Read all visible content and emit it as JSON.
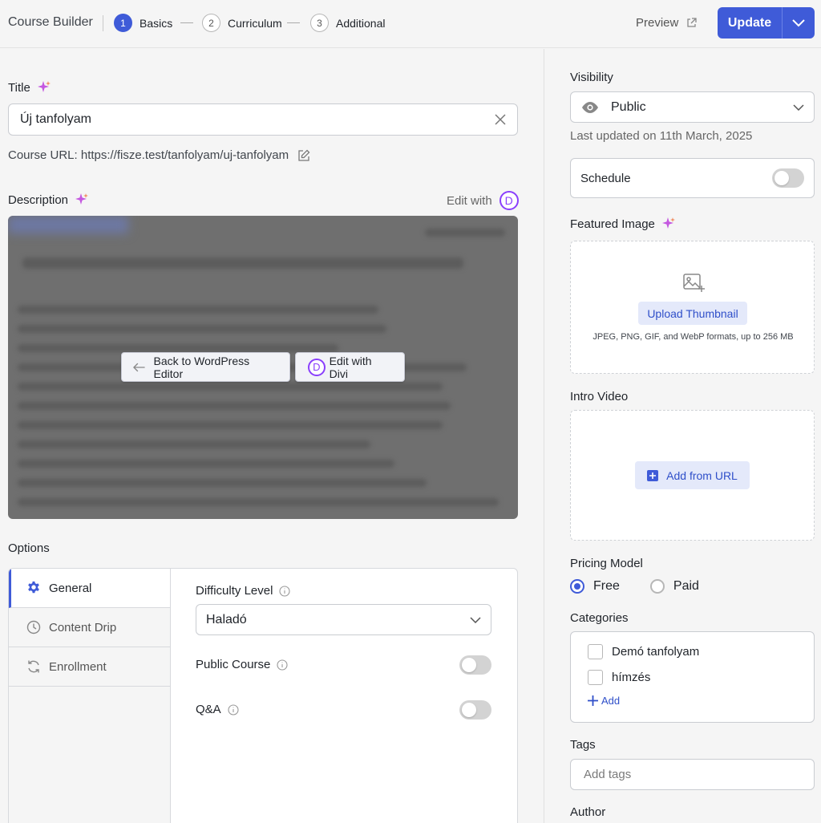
{
  "header": {
    "app_title": "Course Builder",
    "steps": [
      {
        "num": "1",
        "label": "Basics"
      },
      {
        "num": "2",
        "label": "Curriculum"
      },
      {
        "num": "3",
        "label": "Additional"
      }
    ],
    "preview_label": "Preview",
    "update_label": "Update"
  },
  "main": {
    "title_label": "Title",
    "title_value": "Új tanfolyam",
    "course_url": "Course URL: https://fisze.test/tanfolyam/uj-tanfolyam",
    "description_label": "Description",
    "edit_with_label": "Edit with",
    "divi_letter": "D",
    "back_to_wp_label": "Back to WordPress Editor",
    "edit_with_divi_label": "Edit with Divi",
    "options_label": "Options",
    "option_tabs": [
      {
        "label": "General",
        "icon": "gear-icon"
      },
      {
        "label": "Content Drip",
        "icon": "clock-icon"
      },
      {
        "label": "Enrollment",
        "icon": "refresh-icon"
      }
    ],
    "difficulty_label": "Difficulty Level",
    "difficulty_value": "Haladó",
    "public_course_label": "Public Course",
    "qa_label": "Q&A"
  },
  "sidebar": {
    "visibility_label": "Visibility",
    "visibility_value": "Public",
    "last_updated": "Last updated on 11th March, 2025",
    "schedule_label": "Schedule",
    "featured_image_label": "Featured Image",
    "upload_thumbnail_label": "Upload Thumbnail",
    "thumbnail_note": "JPEG, PNG, GIF, and WebP formats, up to 256 MB",
    "intro_video_label": "Intro Video",
    "add_from_url_label": "Add from URL",
    "pricing_model_label": "Pricing Model",
    "pricing_options": [
      "Free",
      "Paid"
    ],
    "pricing_selected": "Free",
    "categories_label": "Categories",
    "categories": [
      "Demó tanfolyam",
      "hímzés"
    ],
    "add_category_label": "Add",
    "tags_label": "Tags",
    "tags_placeholder": "Add tags",
    "author_label": "Author"
  },
  "colors": {
    "accent": "#3f5bd8",
    "divi": "#8a3ffc",
    "background": "#f5f5f5"
  }
}
